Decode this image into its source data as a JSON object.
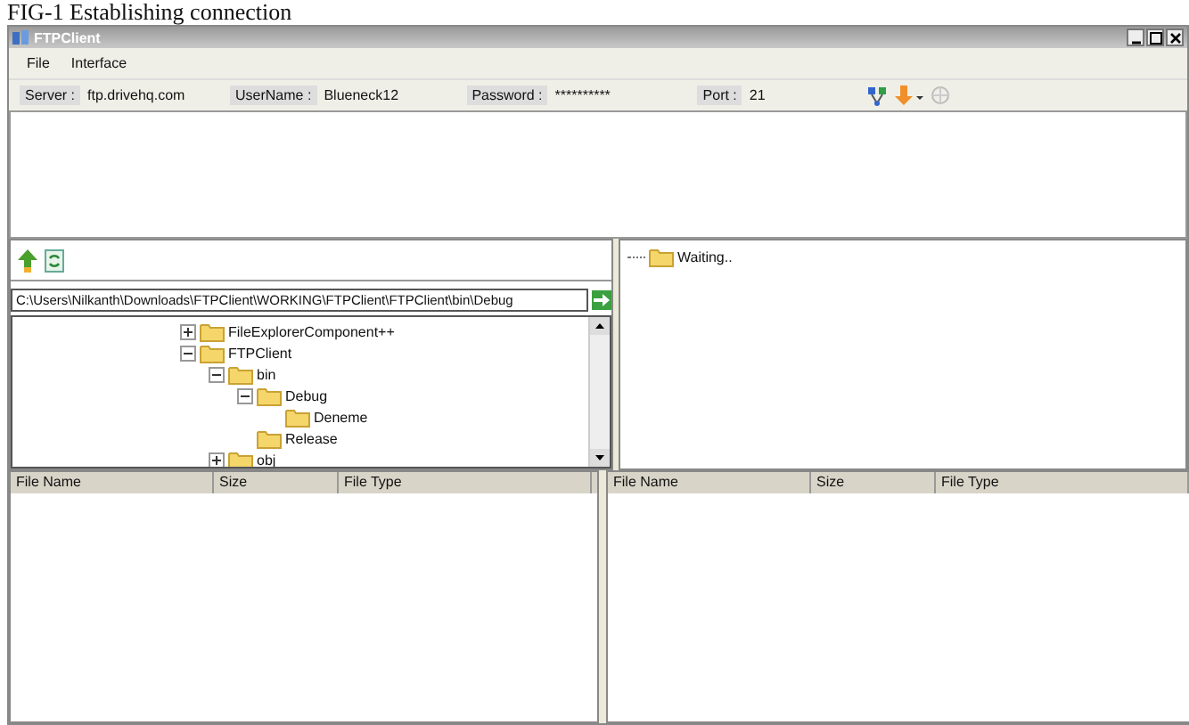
{
  "caption": "FIG-1 Establishing connection",
  "window": {
    "title": "FTPClient"
  },
  "menu": [
    "File",
    "Interface"
  ],
  "connection": [
    {
      "label": "Server :",
      "value": "ftp.drivehq.com"
    },
    {
      "label": "UserName :",
      "value": "Blueneck12"
    },
    {
      "label": "Password :",
      "value": "**********"
    },
    {
      "label": "Port :",
      "value": "21"
    }
  ],
  "local": {
    "path": "C:\\Users\\Nilkanth\\Downloads\\FTPClient\\WORKING\\FTPClient\\FTPClient\\bin\\Debug",
    "tree": [
      {
        "name": "FileExplorerComponent++",
        "expanded": false
      },
      {
        "name": "FTPClient",
        "expanded": true,
        "children": [
          {
            "name": "bin",
            "expanded": true,
            "children": [
              {
                "name": "Debug",
                "expanded": true,
                "children": [
                  {
                    "name": "Deneme"
                  }
                ]
              },
              {
                "name": "Release"
              }
            ]
          },
          {
            "name": "obj",
            "expanded": false
          }
        ]
      }
    ]
  },
  "remote": {
    "tree": [
      {
        "name": "Waiting.."
      }
    ]
  },
  "local_files": {
    "columns": [
      "File Name",
      "Size",
      "File Type"
    ]
  },
  "remote_files": {
    "columns": [
      "File Name",
      "Size",
      "File Type"
    ]
  }
}
